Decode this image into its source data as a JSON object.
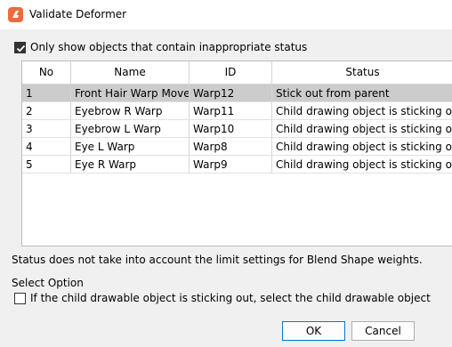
{
  "window": {
    "title": "Validate Deformer"
  },
  "filter": {
    "label": "Only show objects that contain inappropriate status",
    "checked": true
  },
  "table": {
    "columns": [
      "No",
      "Name",
      "ID",
      "Status"
    ],
    "rows": [
      {
        "no": "1",
        "name": "Front Hair Warp Move",
        "id": "Warp12",
        "status": "Stick out from parent",
        "selected": true
      },
      {
        "no": "2",
        "name": "Eyebrow R Warp",
        "id": "Warp11",
        "status": "Child drawing object is sticking out",
        "selected": false
      },
      {
        "no": "3",
        "name": "Eyebrow L Warp",
        "id": "Warp10",
        "status": "Child drawing object is sticking out",
        "selected": false
      },
      {
        "no": "4",
        "name": "Eye L Warp",
        "id": "Warp8",
        "status": "Child drawing object is sticking out",
        "selected": false
      },
      {
        "no": "5",
        "name": "Eye R Warp",
        "id": "Warp9",
        "status": "Child drawing object is sticking out",
        "selected": false
      }
    ]
  },
  "note": "Status does not take into account the limit settings for Blend Shape weights.",
  "select_option": {
    "heading": "Select Option",
    "label": "If the child drawable object is sticking out, select the child drawable object",
    "checked": false
  },
  "buttons": {
    "ok": "OK",
    "cancel": "Cancel"
  },
  "colors": {
    "accent": "#0078d7",
    "app_icon": "#ef6a3a",
    "selected_row": "#cccccc"
  }
}
